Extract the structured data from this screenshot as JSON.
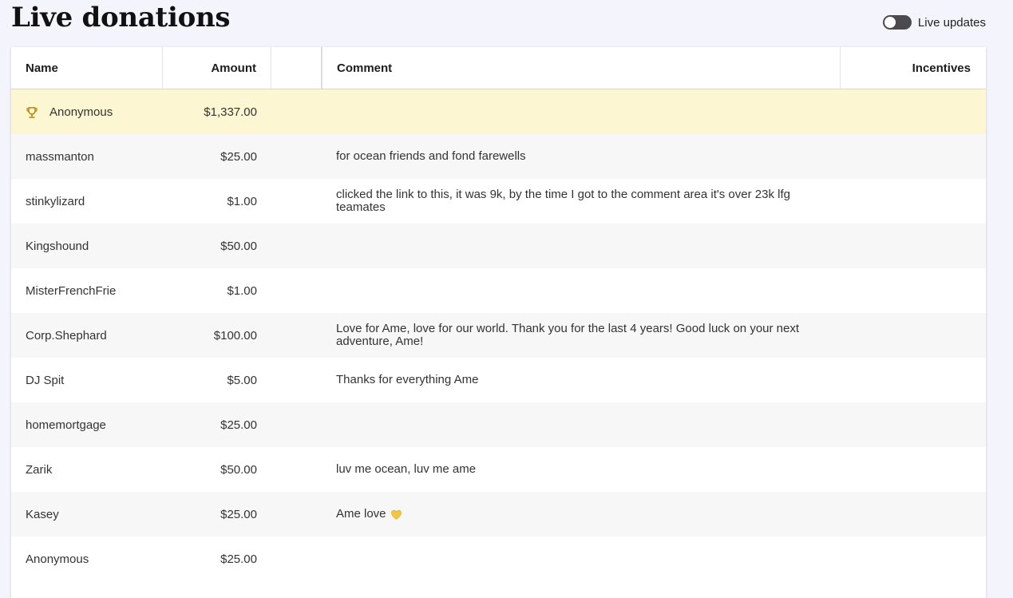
{
  "header": {
    "title": "Live donations",
    "live_toggle_label": "Live updates",
    "live_toggle_on": false
  },
  "table": {
    "columns": [
      "Name",
      "Amount",
      "",
      "Comment",
      "Incentives"
    ],
    "rows": [
      {
        "name": "Anonymous",
        "amount": "$1,337.00",
        "comment": "",
        "top": true
      },
      {
        "name": "massmanton",
        "amount": "$25.00",
        "comment": "for ocean friends and fond farewells"
      },
      {
        "name": "stinkylizard",
        "amount": "$1.00",
        "comment": "clicked the link to this, it was 9k, by the time I got to the comment area it's over 23k lfg teamates"
      },
      {
        "name": "Kingshound",
        "amount": "$50.00",
        "comment": ""
      },
      {
        "name": "MisterFrenchFrie",
        "amount": "$1.00",
        "comment": ""
      },
      {
        "name": "Corp.Shephard",
        "amount": "$100.00",
        "comment": "Love for Ame, love for our world. Thank you for the last 4 years! Good luck on your next adventure, Ame!"
      },
      {
        "name": "DJ Spit",
        "amount": "$5.00",
        "comment": "Thanks for everything Ame"
      },
      {
        "name": "homemortgage",
        "amount": "$25.00",
        "comment": ""
      },
      {
        "name": "Zarik",
        "amount": "$50.00",
        "comment": "luv me ocean, luv me ame"
      },
      {
        "name": "Kasey",
        "amount": "$25.00",
        "comment": "Ame love",
        "heart": true
      },
      {
        "name": "Anonymous",
        "amount": "$25.00",
        "comment": ""
      }
    ]
  },
  "colors": {
    "background": "#f4f4fd",
    "highlight_row": "#fdf6d3",
    "trophy": "#b8860b",
    "heart": "#f2c744",
    "toggle_track": "#4a4a4f"
  },
  "icons": {
    "top_donor": "trophy-icon",
    "comment_emoji": "yellow-heart-icon"
  }
}
